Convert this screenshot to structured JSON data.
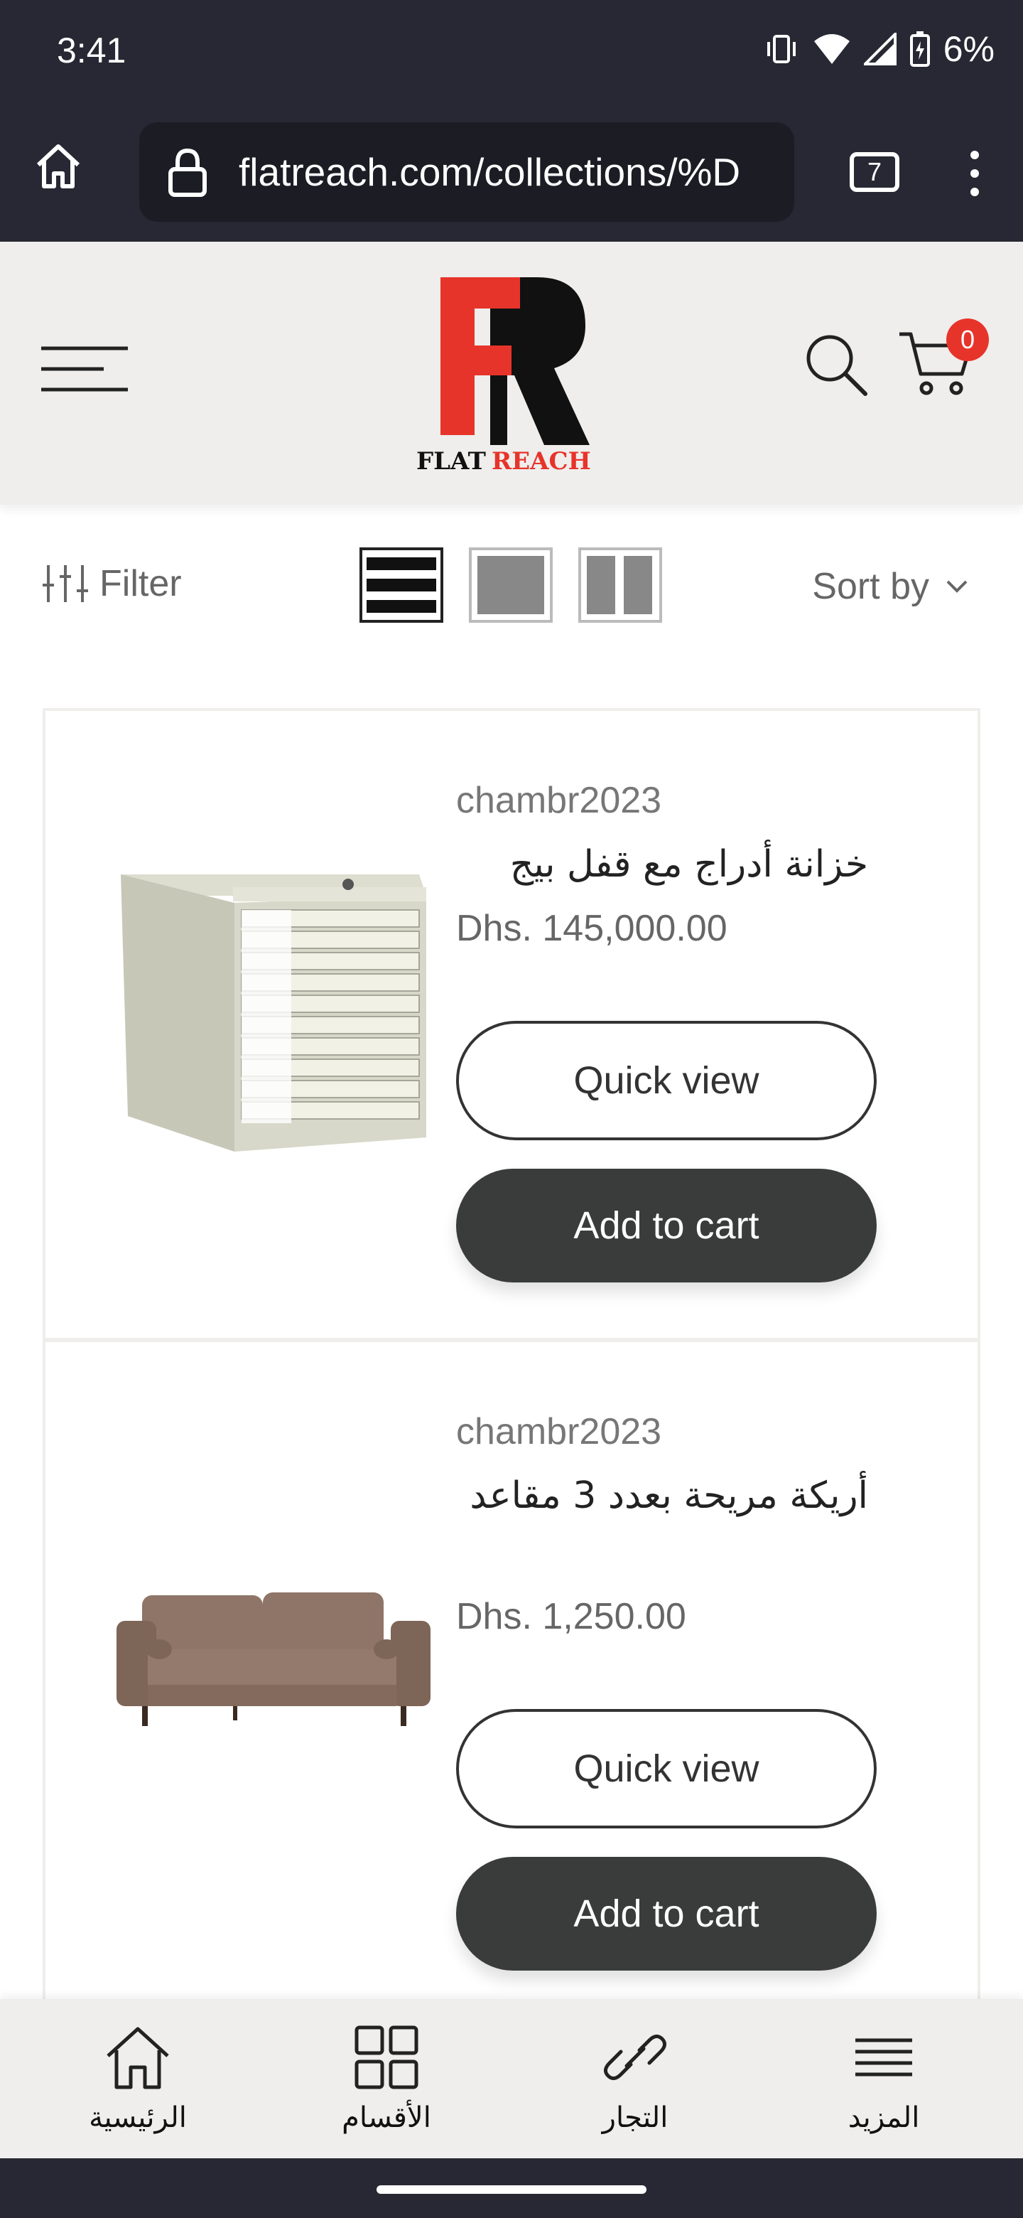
{
  "status_bar": {
    "time": "3:41",
    "battery_percent": "6%"
  },
  "browser": {
    "url": "flatreach.com/collections/%D",
    "tab_count": "7"
  },
  "header": {
    "logo_text_flat": "FLAT",
    "logo_text_reach": "REACH",
    "cart_count": "0",
    "brand_colors": {
      "red": "#e7342b",
      "black": "#111111"
    }
  },
  "toolbar": {
    "filter_label": "Filter",
    "sort_label": "Sort by"
  },
  "products": [
    {
      "vendor": "chambr2023",
      "title": "خزانة أدراج مع قفل بيج",
      "price": "Dhs. 145,000.00",
      "quick_view_label": "Quick view",
      "add_to_cart_label": "Add to cart",
      "image_icon": "drawer-cabinet-image"
    },
    {
      "vendor": "chambr2023",
      "title": "أريكة مريحة بعدد 3 مقاعد",
      "price": "Dhs. 1,250.00",
      "quick_view_label": "Quick view",
      "add_to_cart_label": "Add to cart",
      "image_icon": "sofa-image"
    }
  ],
  "bottom_nav": [
    {
      "label": "الرئيسية",
      "icon": "home-icon"
    },
    {
      "label": "الأقسام",
      "icon": "grid-icon"
    },
    {
      "label": "التجار",
      "icon": "link-icon"
    },
    {
      "label": "المزيد",
      "icon": "menu-icon"
    }
  ]
}
